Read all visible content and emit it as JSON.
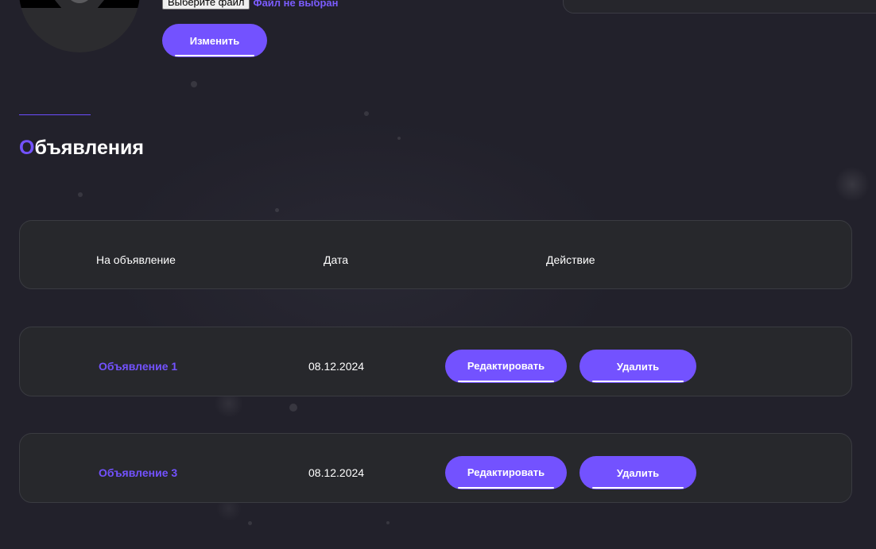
{
  "profile": {
    "file_button_label": "Выберите файл",
    "file_status": "Файл не выбран",
    "change_button_label": "Изменить"
  },
  "section": {
    "title_first_letter": "О",
    "title_rest": "бъявления"
  },
  "table": {
    "headers": [
      "На объявление",
      "Дата",
      "Действие"
    ],
    "rows": [
      {
        "name": "Объявление 1",
        "date": "08.12.2024",
        "edit_label": "Редактировать",
        "delete_label": "Удалить"
      },
      {
        "name": "Объявление 3",
        "date": "08.12.2024",
        "edit_label": "Редактировать",
        "delete_label": "Удалить"
      }
    ]
  },
  "colors": {
    "accent": "#7352ff",
    "background": "#22212b",
    "card": "#27282c"
  }
}
